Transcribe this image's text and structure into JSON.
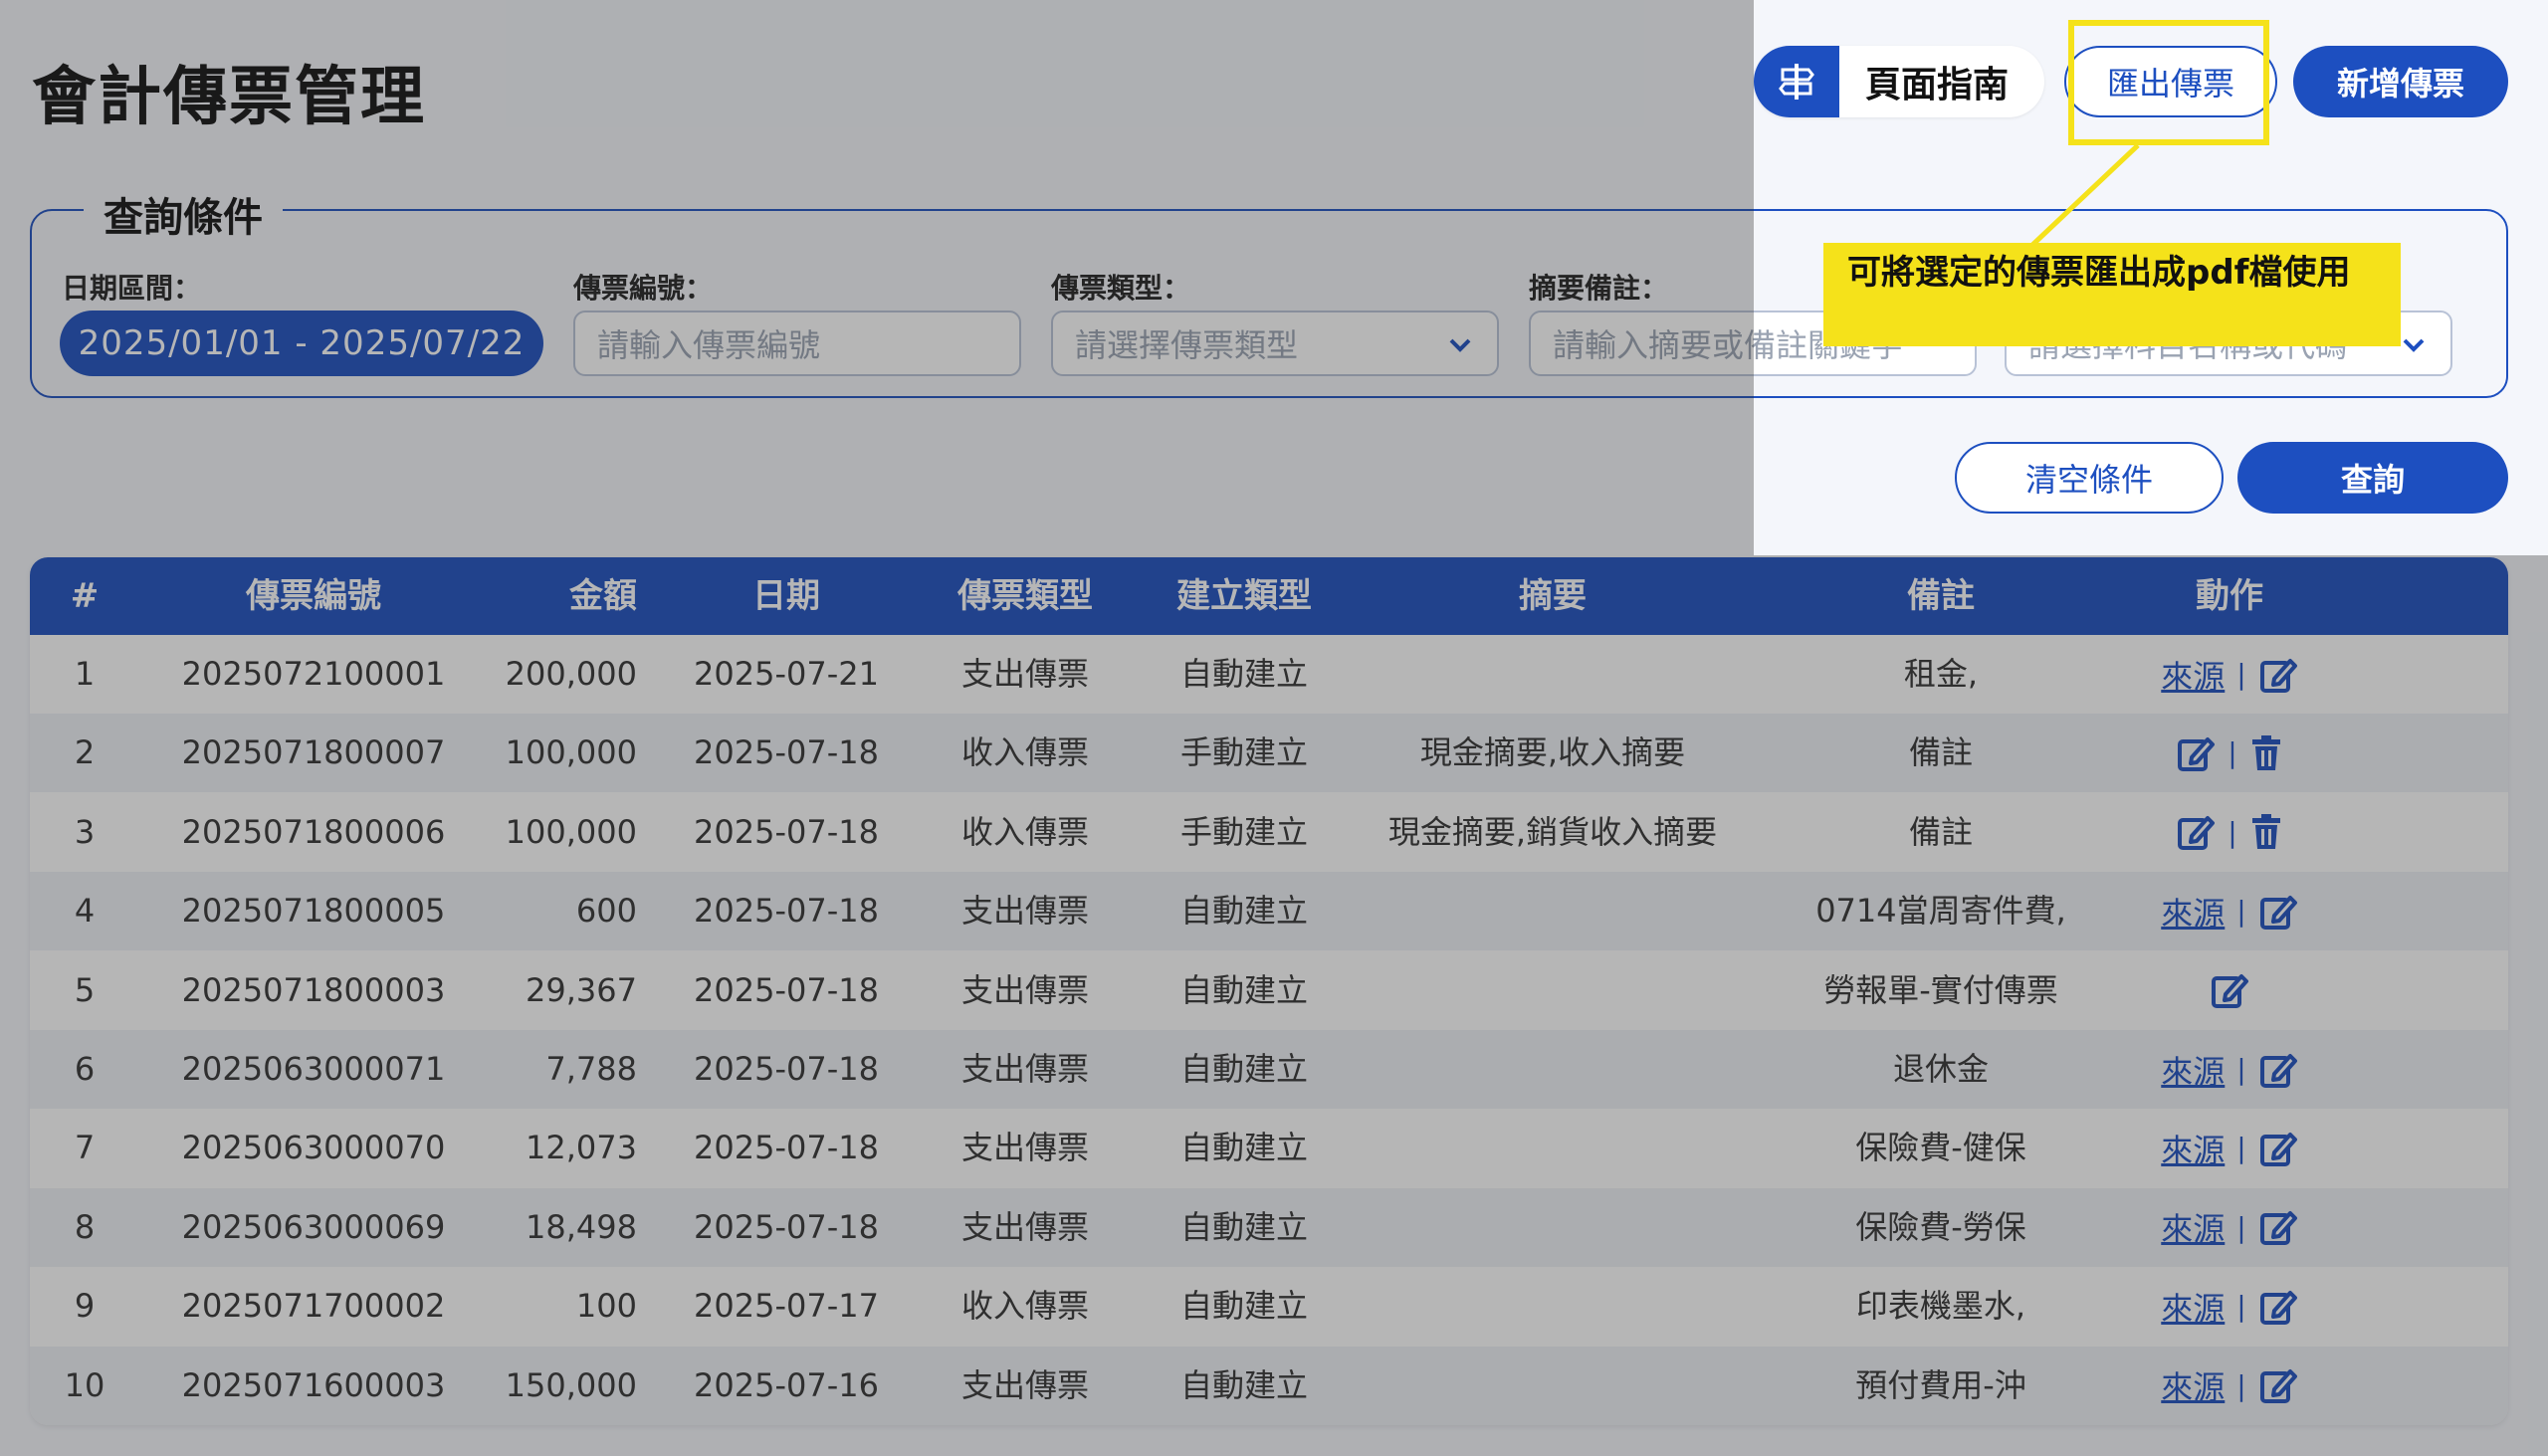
{
  "page": {
    "title": "會計傳票管理"
  },
  "header": {
    "guide_label": "頁面指南",
    "export_label": "匯出傳票",
    "new_label": "新增傳票"
  },
  "query": {
    "legend": "查詢條件",
    "date_label": "日期區間：",
    "date_value": "2025/01/01 - 2025/07/22",
    "voucher_no_label": "傳票編號：",
    "voucher_no_placeholder": "請輸入傳票編號",
    "voucher_type_label": "傳票類型：",
    "voucher_type_placeholder": "請選擇傳票類型",
    "summary_label": "摘要備註：",
    "summary_placeholder": "請輸入摘要或備註關鍵字",
    "account_placeholder": "請選擇科目名稱或代碼",
    "clear_label": "清空條件",
    "search_label": "查詢"
  },
  "tooltip": {
    "text": "可將選定的傳票匯出成pdf檔使用"
  },
  "table": {
    "headers": [
      "#",
      "傳票編號",
      "金額",
      "日期",
      "傳票類型",
      "建立類型",
      "摘要",
      "備註",
      "動作"
    ],
    "source_label": "來源",
    "separator": "|",
    "rows": [
      {
        "n": "1",
        "no": "2025072100001",
        "amount": "200,000",
        "date": "2025-07-21",
        "vtype": "支出傳票",
        "ctype": "自動建立",
        "summary": "",
        "note": "租金,",
        "source": true,
        "edit": true,
        "del": false
      },
      {
        "n": "2",
        "no": "2025071800007",
        "amount": "100,000",
        "date": "2025-07-18",
        "vtype": "收入傳票",
        "ctype": "手動建立",
        "summary": "現金摘要,收入摘要",
        "note": "備註",
        "source": false,
        "edit": true,
        "del": true
      },
      {
        "n": "3",
        "no": "2025071800006",
        "amount": "100,000",
        "date": "2025-07-18",
        "vtype": "收入傳票",
        "ctype": "手動建立",
        "summary": "現金摘要,銷貨收入摘要",
        "note": "備註",
        "source": false,
        "edit": true,
        "del": true
      },
      {
        "n": "4",
        "no": "2025071800005",
        "amount": "600",
        "date": "2025-07-18",
        "vtype": "支出傳票",
        "ctype": "自動建立",
        "summary": "",
        "note": "0714當周寄件費,",
        "source": true,
        "edit": true,
        "del": false
      },
      {
        "n": "5",
        "no": "2025071800003",
        "amount": "29,367",
        "date": "2025-07-18",
        "vtype": "支出傳票",
        "ctype": "自動建立",
        "summary": "",
        "note": "勞報單-實付傳票",
        "source": false,
        "edit": true,
        "del": false
      },
      {
        "n": "6",
        "no": "2025063000071",
        "amount": "7,788",
        "date": "2025-07-18",
        "vtype": "支出傳票",
        "ctype": "自動建立",
        "summary": "",
        "note": "退休金",
        "source": true,
        "edit": true,
        "del": false
      },
      {
        "n": "7",
        "no": "2025063000070",
        "amount": "12,073",
        "date": "2025-07-18",
        "vtype": "支出傳票",
        "ctype": "自動建立",
        "summary": "",
        "note": "保險費-健保",
        "source": true,
        "edit": true,
        "del": false
      },
      {
        "n": "8",
        "no": "2025063000069",
        "amount": "18,498",
        "date": "2025-07-18",
        "vtype": "支出傳票",
        "ctype": "自動建立",
        "summary": "",
        "note": "保險費-勞保",
        "source": true,
        "edit": true,
        "del": false
      },
      {
        "n": "9",
        "no": "2025071700002",
        "amount": "100",
        "date": "2025-07-17",
        "vtype": "收入傳票",
        "ctype": "自動建立",
        "summary": "",
        "note": "印表機墨水,",
        "source": true,
        "edit": true,
        "del": false
      },
      {
        "n": "10",
        "no": "2025071600003",
        "amount": "150,000",
        "date": "2025-07-16",
        "vtype": "支出傳票",
        "ctype": "自動建立",
        "summary": "",
        "note": "預付費用-沖",
        "source": true,
        "edit": true,
        "del": false
      }
    ]
  },
  "colors": {
    "primary": "#1d4fc0",
    "highlight": "#f5e21a"
  }
}
